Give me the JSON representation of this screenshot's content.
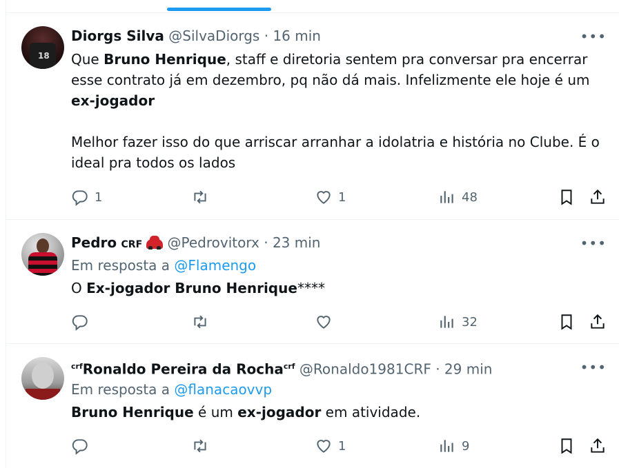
{
  "tweets": [
    {
      "name": "Diorgs Silva",
      "handle": "@SilvaDiorgs",
      "time": "16 min",
      "body_lines": [
        [
          "Que ",
          "Bruno Henrique",
          ", staff e diretoria sentem pra conversar pra encerrar"
        ],
        [
          "esse contrato já em dezembro, pq não dá mais. Infelizmente ele hoje é um"
        ],
        [
          "ex-jogador"
        ],
        [
          ""
        ],
        [
          "Melhor fazer isso do que arriscar arranhar a idolatria e história no Clube. É o"
        ],
        [
          "ideal pra todos os lados"
        ]
      ],
      "replies": "1",
      "likes": "1",
      "views": "48"
    },
    {
      "name": "Pedro",
      "name_badge": "CRF",
      "handle": "@Pedrovitorx",
      "time": "23 min",
      "reply_prefix": "Em resposta a ",
      "reply_mention": "@Flamengo",
      "body_lines": [
        [
          "O ",
          "Ex-jogador Bruno Henrique",
          "****"
        ]
      ],
      "replies": "",
      "likes": "",
      "views": "32"
    },
    {
      "name_prefix": "crf",
      "name": "Ronaldo Pereira da Rocha",
      "name_suffix": "crf",
      "handle": "@Ronaldo1981CRF",
      "time": "29 min",
      "reply_prefix": "Em resposta a ",
      "reply_mention": "@flanacaovvp",
      "body_lines": [
        [
          "",
          "Bruno Henrique",
          " é um ",
          "ex-jogador",
          " em atividade."
        ]
      ],
      "replies": "",
      "likes": "1",
      "views": "9"
    }
  ],
  "separator": " · ",
  "more_label": "•••",
  "icons": [
    "reply-icon",
    "retweet-icon",
    "like-icon",
    "views-icon",
    "bookmark-icon",
    "share-icon"
  ],
  "colors": {
    "accent": "#1d9bf0",
    "muted": "#536471",
    "text": "#0f1419"
  }
}
